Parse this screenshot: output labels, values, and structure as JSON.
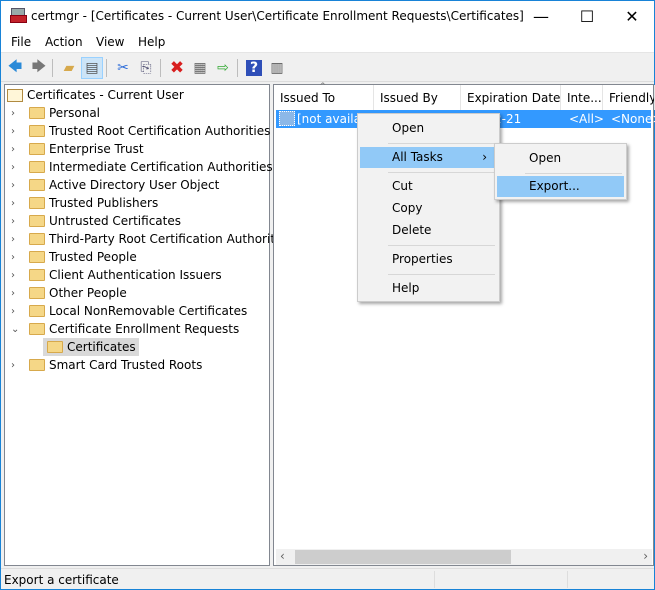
{
  "window": {
    "title": "certmgr - [Certificates - Current User\\Certificate Enrollment Requests\\Certificates]",
    "controls": [
      "minimize",
      "maximize",
      "close"
    ]
  },
  "menu": [
    "File",
    "Action",
    "View",
    "Help"
  ],
  "toolbar": [
    "back-icon",
    "forward-icon",
    "up-folder-icon",
    "show-hide-console-tree-icon",
    "cut-icon",
    "copy-icon",
    "delete-icon",
    "properties-icon",
    "export-list-icon",
    "help-icon",
    "show-action-pane-icon"
  ],
  "tree": {
    "root": "Certificates - Current User",
    "items": [
      "Personal",
      "Trusted Root Certification Authorities",
      "Enterprise Trust",
      "Intermediate Certification Authorities",
      "Active Directory User Object",
      "Trusted Publishers",
      "Untrusted Certificates",
      "Third-Party Root Certification Authorities",
      "Trusted People",
      "Client Authentication Issuers",
      "Other People",
      "Local NonRemovable Certificates",
      "Certificate Enrollment Requests",
      "Smart Card Trusted Roots"
    ],
    "expanded": "Certificate Enrollment Requests",
    "child": "Certificates"
  },
  "list": {
    "columns": [
      "Issued To",
      "Issued By",
      "Expiration Date",
      "Inte...",
      "Friendly"
    ],
    "rows": [
      {
        "issued_to": "[not availab",
        "expiration": "2-21",
        "intended": "<All>",
        "friendly": "<None>"
      }
    ]
  },
  "context_menu": {
    "items": [
      "Open",
      "All Tasks",
      "Cut",
      "Copy",
      "Delete",
      "Properties",
      "Help"
    ],
    "submenu": [
      "Open",
      "Export..."
    ]
  },
  "status": "Export a certificate",
  "colors": {
    "selection": "#3399ff",
    "menu_highlight": "#91c9f7"
  }
}
